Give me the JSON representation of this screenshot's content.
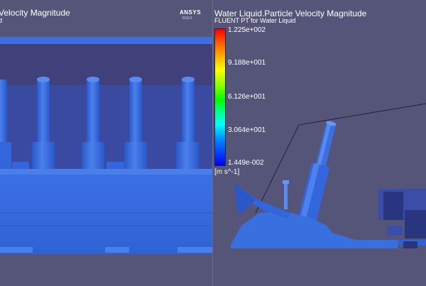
{
  "left_panel": {
    "title": "Velocity Magnitude",
    "subtitle": "d",
    "brand": "ANSYS",
    "brand_version": "R16.0"
  },
  "right_panel": {
    "title": "Water Liquid.Particle Velocity Magnitude",
    "subtitle": "FLUENT PT for Water Liquid"
  },
  "colorbar": {
    "labels": [
      "1.225e+002",
      "9.188e+001",
      "6.126e+001",
      "3.064e+001",
      "1.449e-002"
    ],
    "units": "[m s^-1]",
    "colors": [
      "#ff0000",
      "#ffff00",
      "#00ff00",
      "#00ffff",
      "#0000ff"
    ]
  },
  "colors": {
    "background": "#55557a",
    "geometry": "#3a6fe0",
    "geometry_dark": "#2550b8",
    "geometry_light": "#5a8af0"
  }
}
